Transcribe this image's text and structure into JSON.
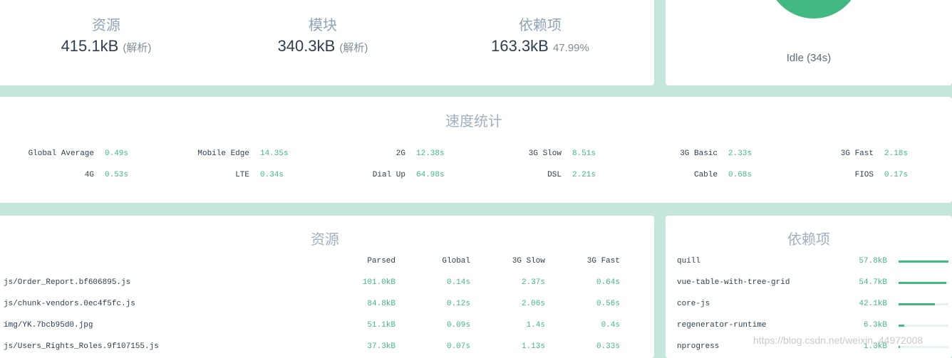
{
  "stats": {
    "assets": {
      "label": "资源",
      "value": "415.1kB",
      "note": "(解析)"
    },
    "modules": {
      "label": "模块",
      "value": "340.3kB",
      "note": "(解析)"
    },
    "dependencies": {
      "label": "依赖项",
      "value": "163.3kB",
      "note": "47.99%"
    }
  },
  "status": {
    "text": "Idle (34s)",
    "color": "#42b983"
  },
  "speed": {
    "title": "速度统计",
    "row1": [
      {
        "name": "Global Average",
        "value": "0.49s"
      },
      {
        "name": "Mobile Edge",
        "value": "14.35s"
      },
      {
        "name": "2G",
        "value": "12.38s"
      },
      {
        "name": "3G Slow",
        "value": "8.51s"
      },
      {
        "name": "3G Basic",
        "value": "2.33s"
      },
      {
        "name": "3G Fast",
        "value": "2.18s"
      }
    ],
    "row2": [
      {
        "name": "4G",
        "value": "0.53s"
      },
      {
        "name": "LTE",
        "value": "0.34s"
      },
      {
        "name": "Dial Up",
        "value": "64.98s"
      },
      {
        "name": "DSL",
        "value": "2.21s"
      },
      {
        "name": "Cable",
        "value": "0.68s"
      },
      {
        "name": "FIOS",
        "value": "0.17s"
      }
    ]
  },
  "assets": {
    "title": "资源",
    "columns": [
      "Parsed",
      "Global",
      "3G Slow",
      "3G Fast"
    ],
    "rows": [
      {
        "file": "js/Order_Report.bf606895.js",
        "parsed": "101.0kB",
        "global": "0.14s",
        "slow": "2.37s",
        "fast": "0.64s"
      },
      {
        "file": "js/chunk-vendors.0ec4f5fc.js",
        "parsed": "84.8kB",
        "global": "0.12s",
        "slow": "2.06s",
        "fast": "0.56s"
      },
      {
        "file": "img/YK.7bcb95d0.jpg",
        "parsed": "51.1kB",
        "global": "0.09s",
        "slow": "1.4s",
        "fast": "0.4s"
      },
      {
        "file": "js/Users_Rights_Roles.9f107155.js",
        "parsed": "37.3kB",
        "global": "0.07s",
        "slow": "1.13s",
        "fast": "0.33s"
      }
    ]
  },
  "dependencies": {
    "title": "依赖项",
    "items": [
      {
        "name": "quill",
        "size": "57.8kB",
        "ratio": 1.0
      },
      {
        "name": "vue-table-with-tree-grid",
        "size": "54.7kB",
        "ratio": 0.95
      },
      {
        "name": "core-js",
        "size": "42.1kB",
        "ratio": 0.73
      },
      {
        "name": "regenerator-runtime",
        "size": "6.3kB",
        "ratio": 0.11
      },
      {
        "name": "nprogress",
        "size": "1.3kB",
        "ratio": 0.02
      }
    ]
  },
  "watermark": "https://blog.csdn.net/weixin_44972008"
}
